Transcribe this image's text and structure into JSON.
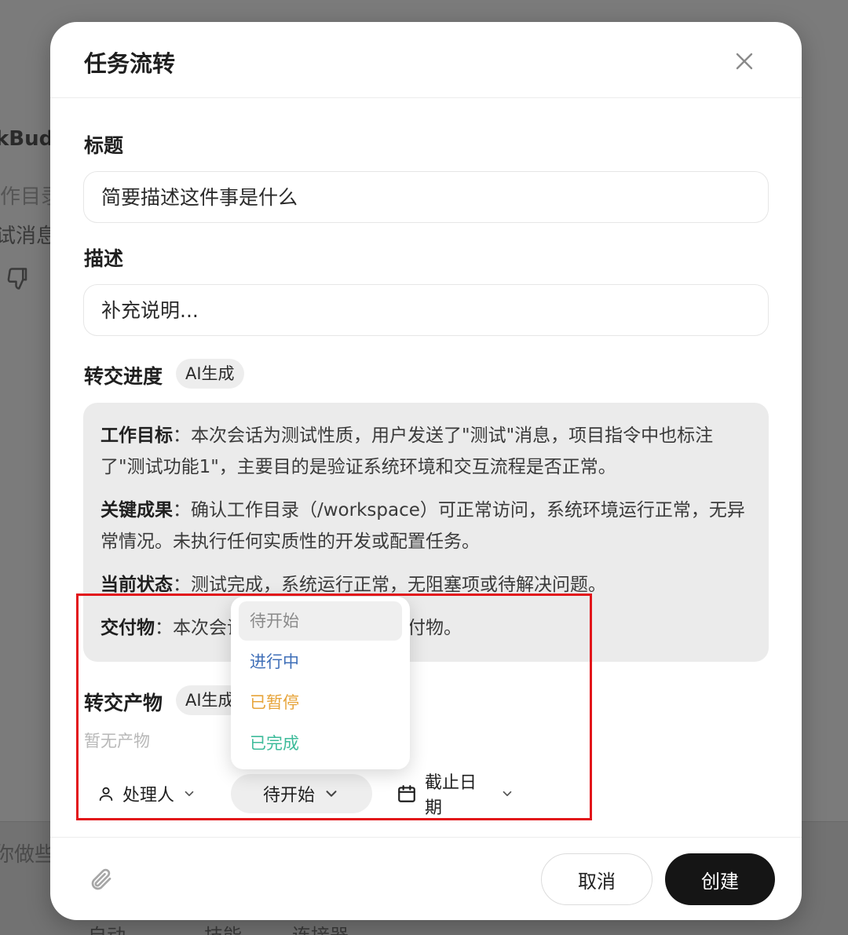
{
  "background": {
    "fragments": [
      "kBudd",
      "作目录",
      "试消息",
      "你做些"
    ],
    "bottom_items": [
      "自动",
      "技能",
      "连接器"
    ]
  },
  "modal": {
    "title": "任务流转",
    "title_label": "标题",
    "title_placeholder": "简要描述这件事是什么",
    "description_label": "描述",
    "description_placeholder": "补充说明...",
    "progress_label": "转交进度",
    "ai_badge": "AI生成",
    "summary": [
      {
        "key": "工作目标",
        "sep": "：",
        "text": "本次会话为测试性质，用户发送了\"测试\"消息，项目指令中也标注了\"测试功能1\"，主要目的是验证系统环境和交互流程是否正常。"
      },
      {
        "key": "关键成果",
        "sep": "：",
        "text": "确认工作目录（/workspace）可正常访问，系统环境运行正常，无异常情况。未执行任何实质性的开发或配置任务。"
      },
      {
        "key": "当前状态",
        "sep": "：",
        "text": "测试完成，系统运行正常，无阻塞项或待解决问题。"
      },
      {
        "key": "交付物",
        "sep": "：",
        "text": "本次会话未产生任何文件或交付物。"
      }
    ],
    "artifacts_label": "转交产物",
    "artifacts_badge": "AI生成",
    "artifacts_empty": "暂无产物",
    "assignee": "处理人",
    "status_selected": "待开始",
    "due_date": "截止日期",
    "cancel": "取消",
    "create": "创建"
  },
  "status_dropdown": {
    "options": [
      {
        "label": "待开始",
        "color": "#8a8a8a"
      },
      {
        "label": "进行中",
        "color": "#3f6fb8"
      },
      {
        "label": "已暂停",
        "color": "#e7a43a"
      },
      {
        "label": "已完成",
        "color": "#3dbb9a"
      }
    ],
    "selected_index": 0
  },
  "colors": {
    "annotation": "#e2141a",
    "primary_button": "#151515"
  }
}
